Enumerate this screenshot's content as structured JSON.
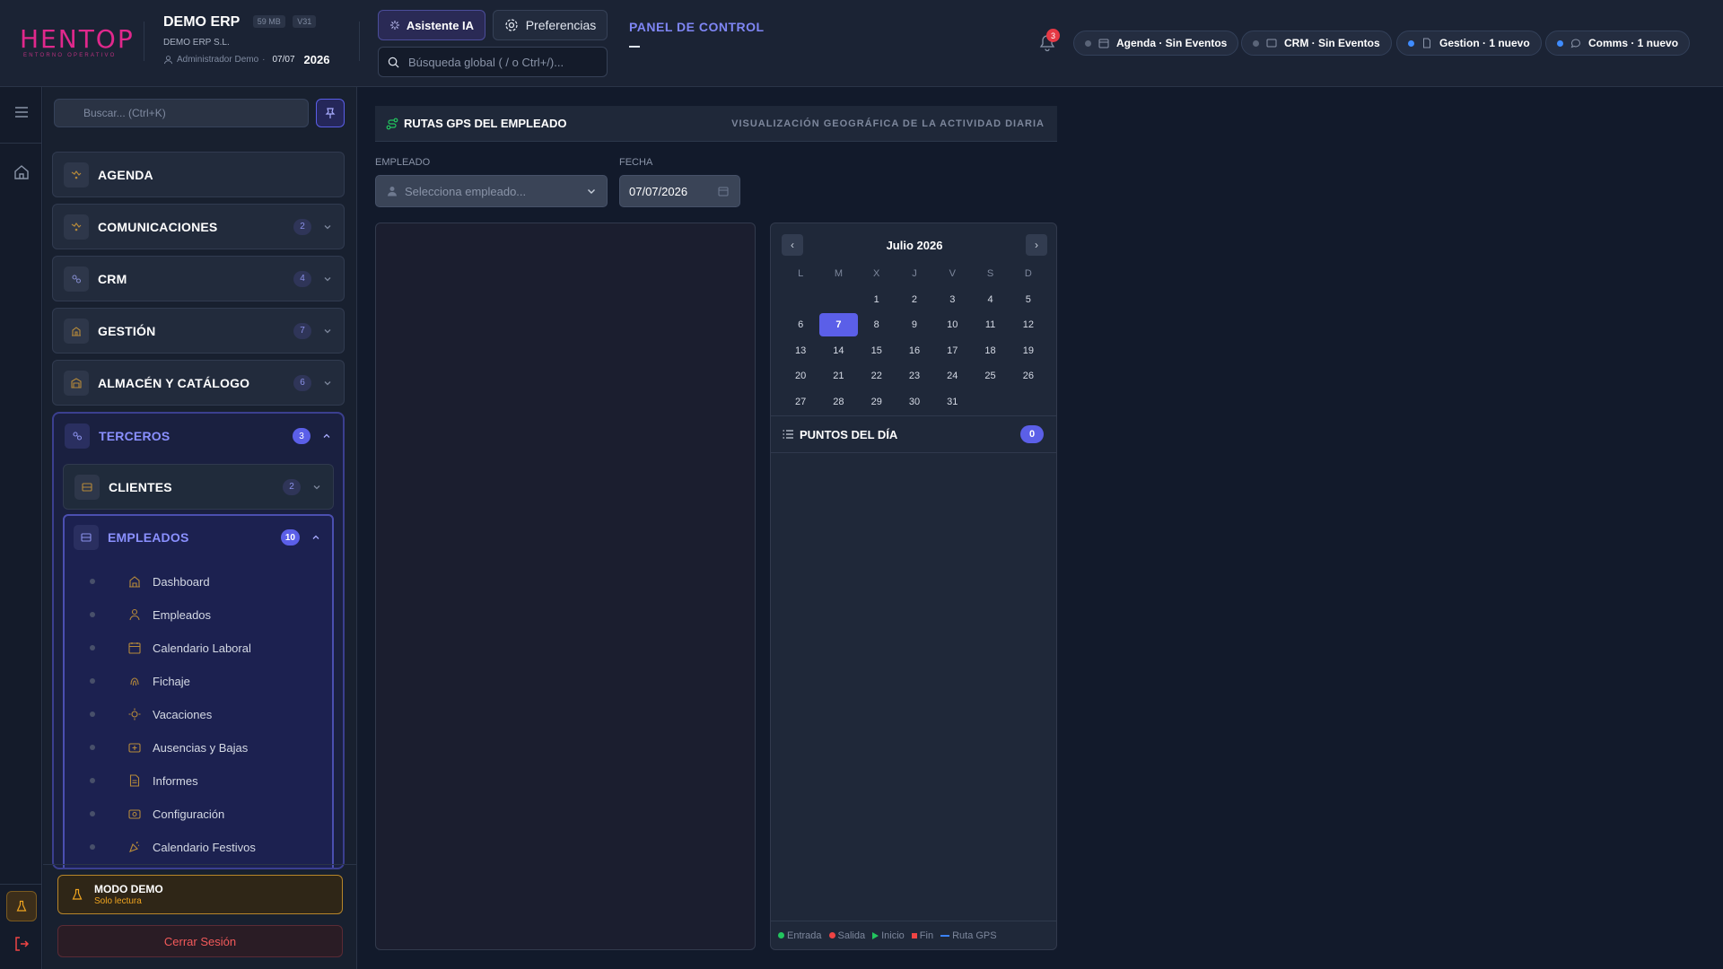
{
  "header": {
    "logo_text": "HENTOP",
    "logo_tagline": "ENTORNO OPERATIVO",
    "company_name": "DEMO ERP",
    "size_badge": "59 MB",
    "version_badge": "V31",
    "company_legal": "DEMO ERP S.L.",
    "user": "Administrador Demo",
    "date_short": "07/07",
    "year": "2026",
    "ai_button": "Asistente IA",
    "prefs_button": "Preferencias",
    "search_placeholder": "Búsqueda global ( / o Ctrl+/)...",
    "panel_title": "PANEL DE CONTROL",
    "notifications_count": "3",
    "status_pills": [
      {
        "label": "Agenda · Sin Eventos",
        "dot_color": "#5a6478",
        "icon": "calendar-icon"
      },
      {
        "label": "CRM · Sin Eventos",
        "dot_color": "#5a6478",
        "icon": "card-icon"
      },
      {
        "label": "Gestion · 1 nuevo",
        "dot_color": "#3f8cff",
        "icon": "document-icon"
      },
      {
        "label": "Comms · 1 nuevo",
        "dot_color": "#3f8cff",
        "icon": "chat-icon"
      }
    ]
  },
  "rail": {
    "items": [
      "menu-icon",
      "home-icon"
    ],
    "bottom": [
      "flask-icon",
      "logout-icon"
    ]
  },
  "sidebar": {
    "search_placeholder": "Buscar... (Ctrl+K)",
    "items": [
      {
        "label": "AGENDA",
        "count": null
      },
      {
        "label": "COMUNICACIONES",
        "count": "2"
      },
      {
        "label": "CRM",
        "count": "4"
      },
      {
        "label": "GESTIÓN",
        "count": "7"
      },
      {
        "label": "ALMACÉN Y CATÁLOGO",
        "count": "6"
      }
    ],
    "open_group": {
      "label": "TERCEROS",
      "count": "3",
      "clientes": {
        "label": "CLIENTES",
        "count": "2"
      },
      "empleados": {
        "label": "EMPLEADOS",
        "count": "10",
        "items": [
          "Dashboard",
          "Empleados",
          "Calendario Laboral",
          "Fichaje",
          "Vacaciones",
          "Ausencias y Bajas",
          "Informes",
          "Configuración",
          "Calendario Festivos"
        ]
      }
    },
    "demo_title": "MODO DEMO",
    "demo_sub": "Solo lectura",
    "logout": "Cerrar Sesión"
  },
  "main": {
    "section_title": "RUTAS GPS DEL EMPLEADO",
    "section_subtitle": "VISUALIZACIÓN GEOGRÁFICA DE LA ACTIVIDAD DIARIA",
    "employee_label": "EMPLEADO",
    "employee_placeholder": "Selecciona empleado...",
    "date_label": "FECHA",
    "date_value": "07/07/2026",
    "calendar": {
      "month_title": "Julio 2026",
      "weekdays": [
        "L",
        "M",
        "X",
        "J",
        "V",
        "S",
        "D"
      ],
      "selected_day": "7",
      "weeks": [
        [
          "",
          "",
          "1",
          "2",
          "3",
          "4",
          "5"
        ],
        [
          "6",
          "7",
          "8",
          "9",
          "10",
          "11",
          "12"
        ],
        [
          "13",
          "14",
          "15",
          "16",
          "17",
          "18",
          "19"
        ],
        [
          "20",
          "21",
          "22",
          "23",
          "24",
          "25",
          "26"
        ],
        [
          "27",
          "28",
          "29",
          "30",
          "31",
          "",
          ""
        ]
      ]
    },
    "points_title": "PUNTOS DEL DÍA",
    "points_count": "0",
    "legend": [
      {
        "label": "Entrada",
        "color": "#22c55e",
        "shape": "dot"
      },
      {
        "label": "Salida",
        "color": "#ef4444",
        "shape": "dot"
      },
      {
        "label": "Inicio",
        "color": "#22c55e",
        "shape": "triangle"
      },
      {
        "label": "Fin",
        "color": "#ef4444",
        "shape": "square"
      },
      {
        "label": "Ruta GPS",
        "color": "#3b82f6",
        "shape": "line"
      }
    ]
  }
}
